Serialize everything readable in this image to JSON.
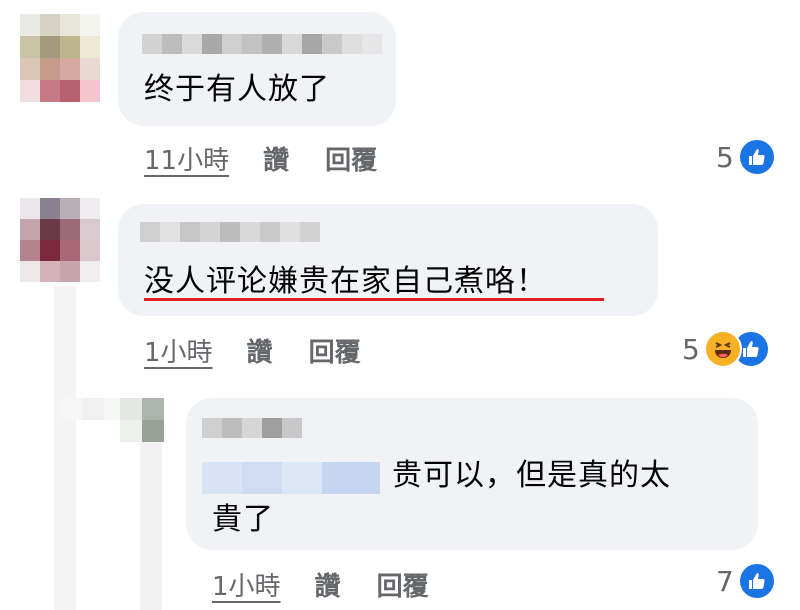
{
  "comments": [
    {
      "text": "终于有人放了",
      "time": "11小時",
      "like_label": "讚",
      "reply_label": "回覆",
      "reaction_count": "5",
      "reactions": [
        "like-icon"
      ]
    },
    {
      "text": "没人评论嫌贵在家自己煮咯！",
      "time": "1小時",
      "like_label": "讚",
      "reply_label": "回覆",
      "reaction_count": "5",
      "reactions": [
        "haha-icon",
        "like-icon"
      ],
      "underline_color": "#e02020"
    }
  ],
  "reply": {
    "text_line1": "贵可以，但是真的太",
    "text_line2": "貴了",
    "time": "1小時",
    "like_label": "讚",
    "reply_label": "回覆",
    "reaction_count": "7",
    "reactions": [
      "like-icon"
    ]
  },
  "colors": {
    "bubble": "#f0f2f5",
    "meta_text": "#65676b",
    "like_blue": "#1b74e4",
    "haha_yellow": "#f7b125"
  }
}
